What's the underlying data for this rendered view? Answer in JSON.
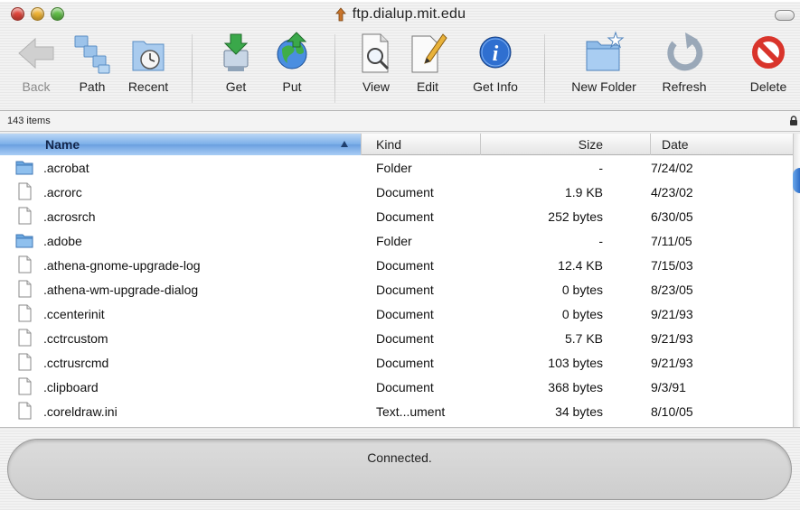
{
  "window": {
    "title": "ftp.dialup.mit.edu"
  },
  "toolbar": {
    "back_label": "Back",
    "path_label": "Path",
    "recent_label": "Recent",
    "get_label": "Get",
    "put_label": "Put",
    "view_label": "View",
    "edit_label": "Edit",
    "get_info_label": "Get Info",
    "new_folder_label": "New Folder",
    "refresh_label": "Refresh",
    "delete_label": "Delete"
  },
  "status": {
    "items_count": "143 items",
    "connection": "Connected."
  },
  "columns": {
    "name": "Name",
    "kind": "Kind",
    "size": "Size",
    "date": "Date"
  },
  "files": [
    {
      "icon": "folder-icon",
      "name": ".acrobat",
      "kind": "Folder",
      "size": "-",
      "date": "7/24/02"
    },
    {
      "icon": "document-icon",
      "name": ".acrorc",
      "kind": "Document",
      "size": "1.9 KB",
      "date": "4/23/02"
    },
    {
      "icon": "document-icon",
      "name": ".acrosrch",
      "kind": "Document",
      "size": "252 bytes",
      "date": "6/30/05"
    },
    {
      "icon": "folder-icon",
      "name": ".adobe",
      "kind": "Folder",
      "size": "-",
      "date": "7/11/05"
    },
    {
      "icon": "document-icon",
      "name": ".athena-gnome-upgrade-log",
      "kind": "Document",
      "size": "12.4 KB",
      "date": "7/15/03"
    },
    {
      "icon": "document-icon",
      "name": ".athena-wm-upgrade-dialog",
      "kind": "Document",
      "size": "0 bytes",
      "date": "8/23/05"
    },
    {
      "icon": "document-icon",
      "name": ".ccenterinit",
      "kind": "Document",
      "size": "0 bytes",
      "date": "9/21/93"
    },
    {
      "icon": "document-icon",
      "name": ".cctrcustom",
      "kind": "Document",
      "size": "5.7 KB",
      "date": "9/21/93"
    },
    {
      "icon": "document-icon",
      "name": ".cctrusrcmd",
      "kind": "Document",
      "size": "103 bytes",
      "date": "9/21/93"
    },
    {
      "icon": "document-icon",
      "name": ".clipboard",
      "kind": "Document",
      "size": "368 bytes",
      "date": "9/3/91"
    },
    {
      "icon": "document-icon",
      "name": ".coreldraw.ini",
      "kind": "Text...ument",
      "size": "34 bytes",
      "date": "8/10/05"
    }
  ],
  "colors": {
    "sorted_header": "#7aaee8",
    "folder": "#6aa7e0",
    "get_arrow": "#3aa84a",
    "info_blue": "#2f6fd0",
    "delete_red": "#d9342b"
  }
}
